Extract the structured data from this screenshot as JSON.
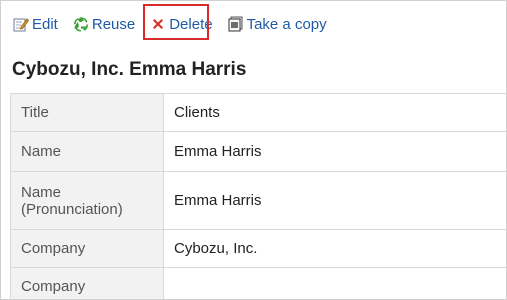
{
  "toolbar": {
    "edit_label": "Edit",
    "reuse_label": "Reuse",
    "delete_label": "Delete",
    "copy_label": "Take a copy"
  },
  "colors": {
    "link": "#1f5aa6",
    "highlight": "#d92b2b",
    "label_bg": "#f2f2f2",
    "border": "#d8d8d8"
  },
  "record": {
    "title": "Cybozu, Inc. Emma Harris",
    "rows": [
      {
        "label": "Title",
        "value": "Clients"
      },
      {
        "label": "Name",
        "value": "Emma Harris"
      },
      {
        "label": "Name\n(Pronunciation)",
        "value": "Emma Harris"
      },
      {
        "label": "Company",
        "value": "Cybozu, Inc."
      },
      {
        "label": "Company",
        "value": ""
      }
    ]
  }
}
